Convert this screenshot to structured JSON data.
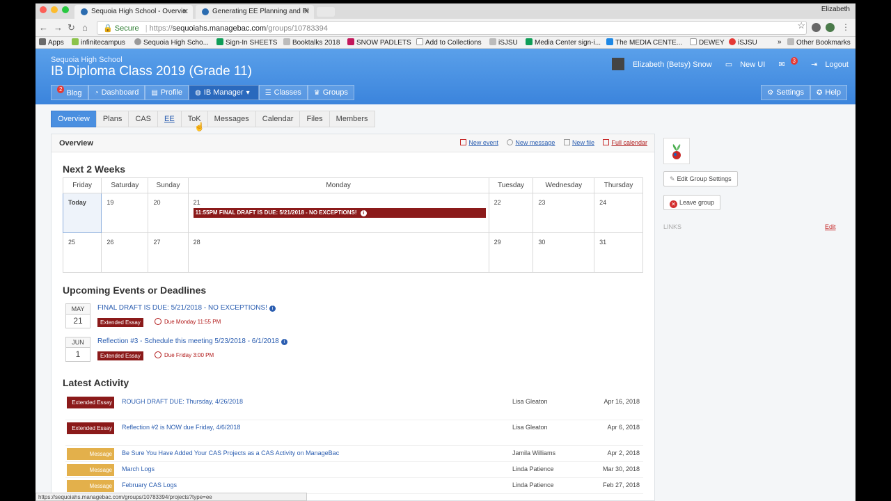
{
  "browser": {
    "tabs": [
      {
        "title": "Sequoia High School - Overvie"
      },
      {
        "title": "Generating EE Planning and Pl"
      }
    ],
    "profile": "Elizabeth",
    "url_secure": "Secure",
    "url_scheme": "https://",
    "url_host": "sequoiahs.managebac.com",
    "url_path": "/groups/10783394",
    "bookmarks": [
      "Apps",
      "infinitecampus",
      "Sequoia High Scho...",
      "Sign-In SHEETS",
      "Booktalks 2018",
      "SNOW PADLETS",
      "Add to Collections",
      "iSJSU",
      "Media Center sign-i...",
      "The MEDIA CENTE...",
      "DEWEY",
      "iSJSU",
      "»",
      "Other Bookmarks"
    ],
    "status_url": "https://sequoiahs.managebac.com/groups/10783394/projects?type=ee"
  },
  "header": {
    "school": "Sequoia High School",
    "title": "IB Diploma Class 2019 (Grade 11)",
    "user": "Elizabeth (Betsy) Snow",
    "new_ui": "New UI",
    "notif_count": "3",
    "logout": "Logout",
    "blog_badge": "2",
    "nav": [
      "Blog",
      "Dashboard",
      "Profile",
      "IB Manager",
      "Classes",
      "Groups"
    ],
    "nav_right": [
      "Settings",
      "Help"
    ]
  },
  "subtabs": [
    "Overview",
    "Plans",
    "CAS",
    "EE",
    "ToK",
    "Messages",
    "Calendar",
    "Files",
    "Members"
  ],
  "panel": {
    "title": "Overview",
    "actions": [
      "New event",
      "New message",
      "New file",
      "Full calendar"
    ]
  },
  "next2weeks": {
    "title": "Next 2 Weeks",
    "days": [
      "Friday",
      "Saturday",
      "Sunday",
      "Monday",
      "Tuesday",
      "Wednesday",
      "Thursday"
    ],
    "week1": [
      "Today",
      "19",
      "20",
      "21",
      "22",
      "23",
      "24"
    ],
    "week2": [
      "25",
      "26",
      "27",
      "28",
      "29",
      "30",
      "31"
    ],
    "event_time": "11:55PM",
    "event_text": "FINAL DRAFT IS DUE: 5/21/2018 - NO EXCEPTIONS!"
  },
  "upcoming": {
    "title": "Upcoming Events or Deadlines",
    "items": [
      {
        "month": "MAY",
        "day": "21",
        "title": "FINAL DRAFT IS DUE: 5/21/2018 - NO EXCEPTIONS!",
        "tag": "Extended Essay",
        "due": "Due Monday 11:55 PM"
      },
      {
        "month": "JUN",
        "day": "1",
        "title": "Reflection #3 - Schedule this meeting 5/23/2018 - 6/1/2018",
        "tag": "Extended Essay",
        "due": "Due Friday 3:00 PM"
      }
    ]
  },
  "activity": {
    "title": "Latest Activity",
    "rows": [
      {
        "tag": "Extended Essay",
        "title": "ROUGH DRAFT DUE: Thursday, 4/26/2018",
        "author": "Lisa Gleaton",
        "date": "Apr 16, 2018"
      },
      {
        "tag": "Extended Essay",
        "title": "Reflection #2 is NOW due Friday, 4/6/2018",
        "author": "Lisa Gleaton",
        "date": "Apr 6, 2018"
      },
      {
        "tag": "Message",
        "title": "Be Sure You Have Added Your CAS Projects as a CAS Activity on ManageBac",
        "author": "Jamila Williams",
        "date": "Apr 2, 2018"
      },
      {
        "tag": "Message",
        "title": "March Logs",
        "author": "Linda Patience",
        "date": "Mar 30, 2018"
      },
      {
        "tag": "Message",
        "title": "February CAS Logs",
        "author": "Linda Patience",
        "date": "Feb 27, 2018"
      }
    ]
  },
  "sidebar": {
    "edit_group": "Edit Group Settings",
    "leave_group": "Leave group",
    "links_label": "LINKS",
    "links_edit": "Edit"
  }
}
